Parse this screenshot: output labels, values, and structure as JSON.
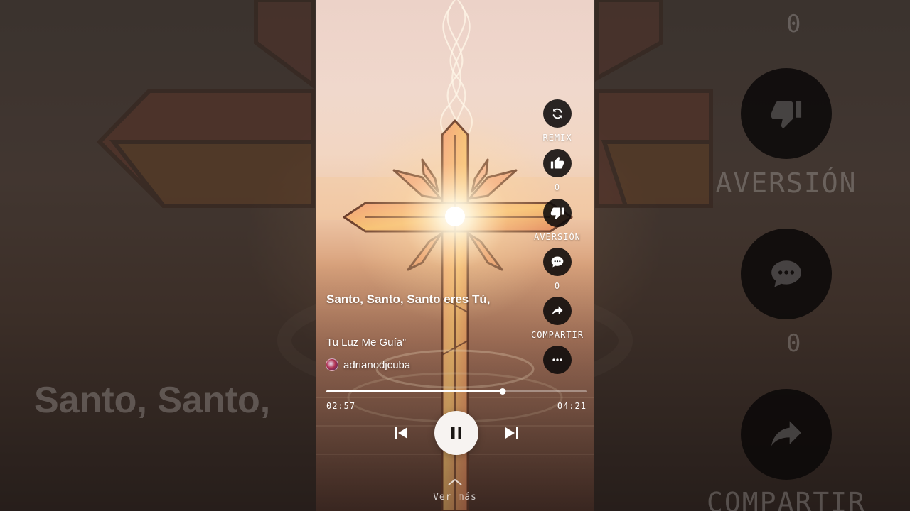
{
  "colors": {
    "action_button_bg": "#0c0a0a",
    "progress_fill": "#ffffff",
    "play_button_bg": "#f7f3f1"
  },
  "background": {
    "lyric_echo": "Santo, Santo,",
    "counts": [
      "0",
      "0"
    ],
    "labels": [
      "AVERSIÓN",
      "COMPARTIR"
    ],
    "icons": [
      "thumbs-down-icon",
      "comment-icon",
      "share-icon"
    ]
  },
  "actions": [
    {
      "name": "remix",
      "icon": "remix-icon",
      "label": "REMIX"
    },
    {
      "name": "like",
      "icon": "thumbs-up-icon",
      "label": "0"
    },
    {
      "name": "dislike",
      "icon": "thumbs-down-icon",
      "label": "AVERSIÓN"
    },
    {
      "name": "comments",
      "icon": "comment-icon",
      "label": "0"
    },
    {
      "name": "share",
      "icon": "share-icon",
      "label": "COMPARTIR"
    },
    {
      "name": "more",
      "icon": "more-horizontal-icon",
      "label": ""
    }
  ],
  "lyrics": {
    "line1": "Santo, Santo, Santo eres Tú,",
    "line2": "Tu Luz Me Guía”"
  },
  "channel": {
    "name": "adrianodjcuba"
  },
  "player": {
    "elapsed": "02:57",
    "duration": "04:21",
    "progress": 0.678,
    "state": "playing"
  },
  "footer": {
    "expand_icon": "chevron-up-icon",
    "more_label": "Ver más"
  }
}
